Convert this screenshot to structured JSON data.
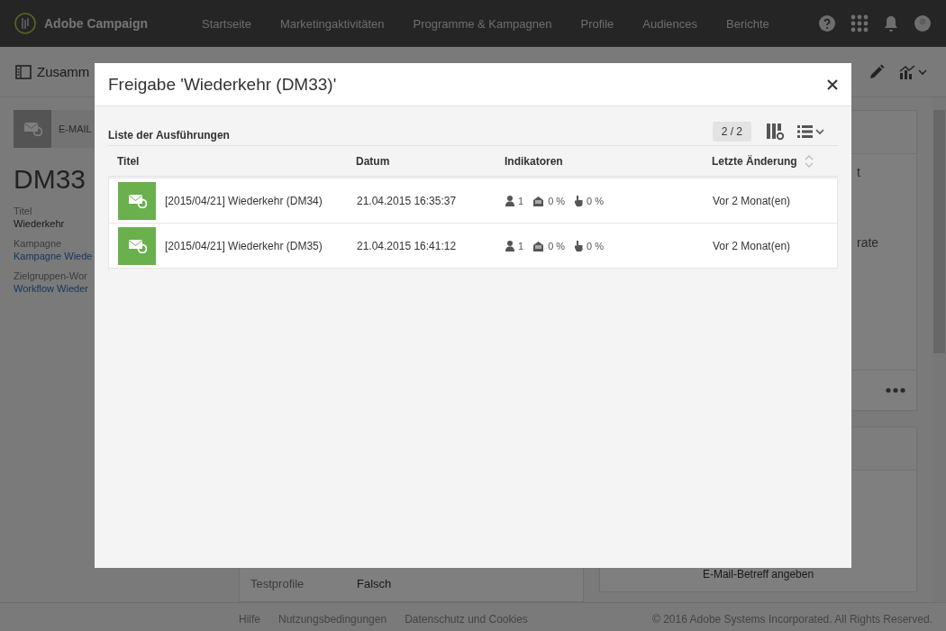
{
  "app": {
    "name": "Adobe Campaign"
  },
  "nav": [
    {
      "label": "Startseite"
    },
    {
      "label": "Marketingaktivitäten"
    },
    {
      "label": "Programme & Kampagnen"
    },
    {
      "label": "Profile"
    },
    {
      "label": "Audiences"
    },
    {
      "label": "Berichte"
    }
  ],
  "header": {
    "title": "Zusamm"
  },
  "summary": {
    "channel": "E-MAIL",
    "name": "DM33",
    "fields": [
      {
        "label": "Titel",
        "value": "Wiederkehr",
        "kind": "text"
      },
      {
        "label": "Kampagne",
        "value": "Kampagne Wiede",
        "kind": "link"
      },
      {
        "label": "Zielgruppen-Wor",
        "value": "Workflow Wieder",
        "kind": "link"
      }
    ]
  },
  "properties": [
    {
      "label": "Testprofile",
      "value": "Falsch"
    }
  ],
  "stats": [
    {
      "label": "t"
    },
    {
      "label": "rate"
    }
  ],
  "preview": {
    "hint": "E-Mail-Betreff angeben"
  },
  "footer": {
    "links": [
      "Hilfe",
      "Nutzungsbedingungen",
      "Datenschutz und Cookies"
    ],
    "copyright": "© 2016 Adobe Systems Incorporated. All Rights Reserved."
  },
  "dialog": {
    "title": "Freigabe 'Wiederkehr (DM33)'",
    "list_title": "Liste der Ausführungen",
    "pager": "2 / 2",
    "columns": [
      {
        "label": "Titel",
        "kind": "plain"
      },
      {
        "label": "Datum",
        "kind": "plain"
      },
      {
        "label": "Indikatoren",
        "kind": "plain"
      },
      {
        "label": "Letzte Änderung",
        "kind": "sortable"
      }
    ],
    "rows": [
      {
        "title": "[2015/04/21] Wiederkehr (DM34)",
        "date": "21.04.2015 16:35:37",
        "indicators": [
          {
            "kind": "recipients",
            "value": "1"
          },
          {
            "kind": "opens",
            "value": "0 %"
          },
          {
            "kind": "clicks",
            "value": "0 %"
          }
        ],
        "modified": "Vor 2 Monat(en)"
      },
      {
        "title": "[2015/04/21] Wiederkehr (DM35)",
        "date": "21.04.2015 16:41:12",
        "indicators": [
          {
            "kind": "recipients",
            "value": "1"
          },
          {
            "kind": "opens",
            "value": "0 %"
          },
          {
            "kind": "clicks",
            "value": "0 %"
          }
        ],
        "modified": "Vor 2 Monat(en)"
      }
    ]
  }
}
